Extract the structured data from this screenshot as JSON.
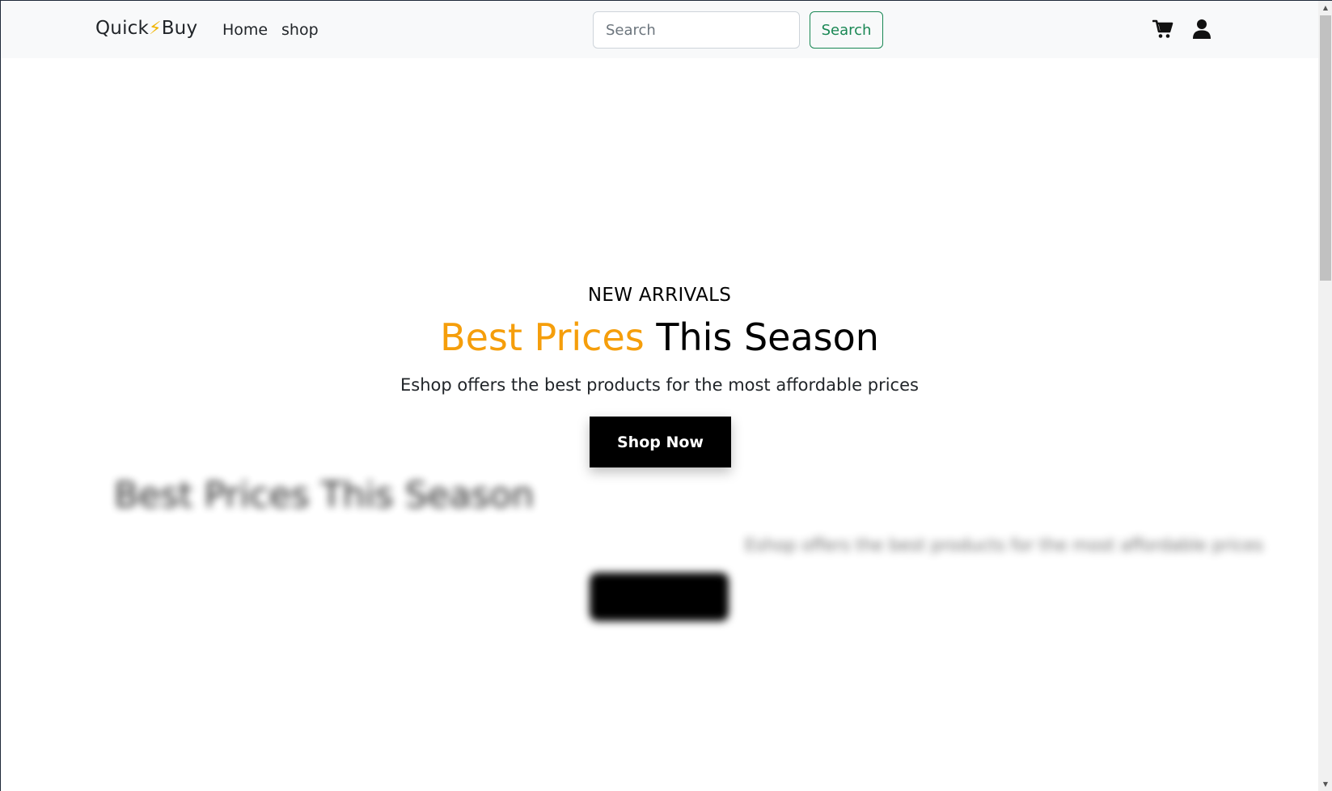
{
  "navbar": {
    "brand_left": "Quick",
    "brand_bolt": "⚡",
    "brand_right": "Buy",
    "links": [
      {
        "label": "Home"
      },
      {
        "label": "shop"
      }
    ],
    "search": {
      "placeholder": "Search",
      "value": "",
      "button_label": "Search"
    },
    "icons": [
      "cart-icon",
      "user-icon"
    ]
  },
  "hero": {
    "eyebrow": "NEW ARRIVALS",
    "headline_accent": "Best Prices",
    "headline_rest": "This Season",
    "subline": "Eshop offers the best products for the most affordable prices",
    "cta_label": "Shop Now",
    "ghost_headline": "Best Prices This Season",
    "ghost_subline": "Eshop offers the best products for the most affordable prices"
  },
  "colors": {
    "accent": "#f59e0b",
    "search_outline": "#198754",
    "navbar_bg": "#f8f9fa",
    "cta_bg": "#000000"
  }
}
